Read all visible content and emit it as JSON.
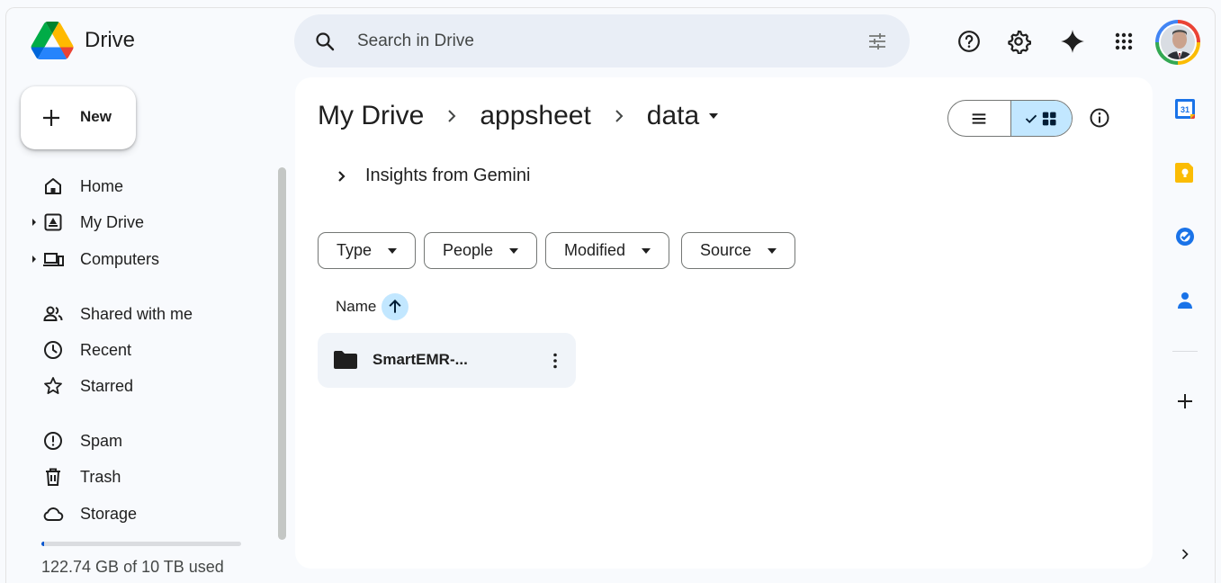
{
  "app": {
    "name": "Drive"
  },
  "header": {
    "search_placeholder": "Search in Drive",
    "icons": [
      "help-icon",
      "settings-icon",
      "gemini-icon",
      "apps-icon",
      "account-avatar"
    ]
  },
  "sidebar": {
    "new_label": "New",
    "items": [
      {
        "label": "Home",
        "icon": "home-icon",
        "expandable": false
      },
      {
        "label": "My Drive",
        "icon": "my-drive-icon",
        "expandable": true
      },
      {
        "label": "Computers",
        "icon": "computers-icon",
        "expandable": true
      },
      {
        "label": "Shared with me",
        "icon": "shared-icon",
        "expandable": false
      },
      {
        "label": "Recent",
        "icon": "recent-icon",
        "expandable": false
      },
      {
        "label": "Starred",
        "icon": "star-icon",
        "expandable": false
      },
      {
        "label": "Spam",
        "icon": "spam-icon",
        "expandable": false
      },
      {
        "label": "Trash",
        "icon": "trash-icon",
        "expandable": false
      },
      {
        "label": "Storage",
        "icon": "cloud-icon",
        "expandable": false
      }
    ],
    "storage": {
      "text": "122.74 GB of 10 TB used",
      "fraction_used": 0.012
    }
  },
  "main": {
    "breadcrumbs": [
      "My Drive",
      "appsheet",
      "data"
    ],
    "insights_label": "Insights from Gemini",
    "filters": [
      "Type",
      "People",
      "Modified",
      "Source"
    ],
    "sort_column": "Name",
    "view_mode": "grid",
    "folders": [
      {
        "name": "SmartEMR-..."
      }
    ]
  },
  "side_panel": {
    "apps": [
      "calendar-icon",
      "keep-icon",
      "tasks-icon",
      "contacts-icon"
    ],
    "calendar_day": "31"
  },
  "colors": {
    "accent": "#0b57d0",
    "selected": "#c2e7ff",
    "search_bg": "#e9eef6",
    "page_bg": "#f8fafd"
  }
}
